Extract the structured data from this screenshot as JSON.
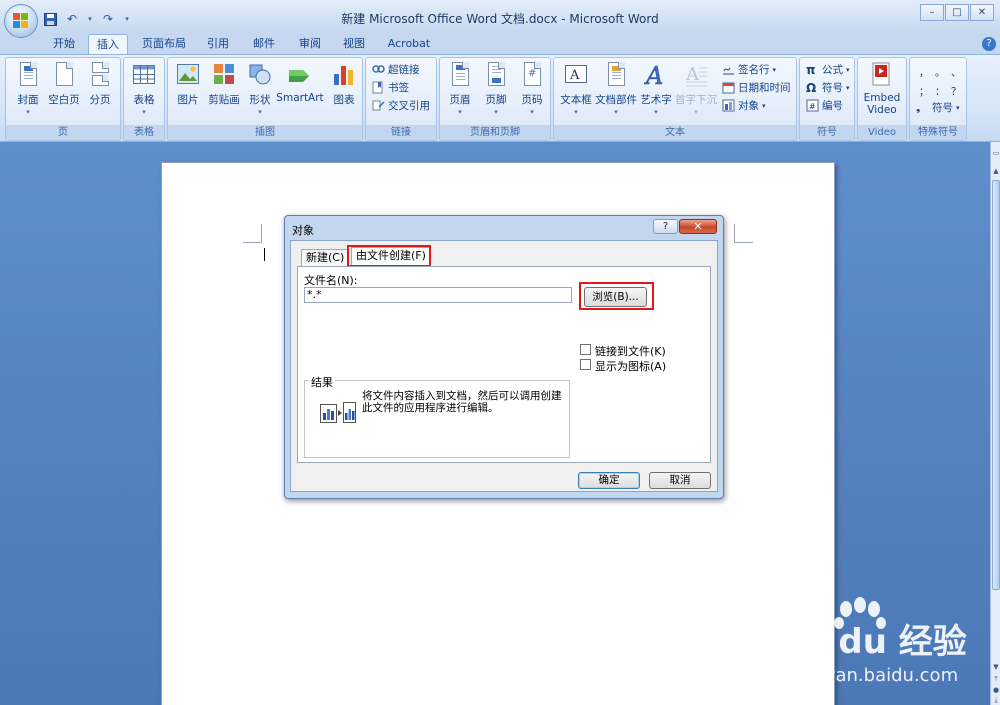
{
  "window": {
    "title": "新建 Microsoft Office Word 文档.docx - Microsoft Word",
    "controls": {
      "minimize": "–",
      "maximize": "□",
      "close": "✕"
    }
  },
  "quick_access": [
    "save-icon",
    "undo-icon",
    "dropdown-icon",
    "redo-icon",
    "customize-icon"
  ],
  "ribbon_tabs": [
    "开始",
    "插入",
    "页面布局",
    "引用",
    "邮件",
    "审阅",
    "视图",
    "Acrobat"
  ],
  "active_tab": "插入",
  "ribbon_groups": {
    "pages": {
      "label": "页",
      "buttons": [
        "封面",
        "空白页",
        "分页"
      ]
    },
    "tables": {
      "label": "表格",
      "buttons": [
        "表格"
      ]
    },
    "illustrations": {
      "label": "插图",
      "buttons": [
        "图片",
        "剪贴画",
        "形状",
        "SmartArt",
        "图表"
      ]
    },
    "links": {
      "label": "链接",
      "buttons": [
        "超链接",
        "书签",
        "交叉引用"
      ]
    },
    "header_footer": {
      "label": "页眉和页脚",
      "buttons": [
        "页眉",
        "页脚",
        "页码"
      ]
    },
    "text": {
      "label": "文本",
      "buttons": [
        "文本框",
        "文档部件",
        "艺术字",
        "首字下沉"
      ],
      "small": [
        "签名行",
        "日期和时间",
        "对象"
      ]
    },
    "symbols": {
      "label": "符号",
      "small": [
        "公式",
        "符号",
        "编号"
      ]
    },
    "video": {
      "label": "Video",
      "button": "Embed Video"
    },
    "special": {
      "label": "特殊符号",
      "symbol_label": "符号",
      "glyphs": [
        "，",
        "。",
        "、",
        "；",
        "：",
        "？"
      ]
    }
  },
  "dialog": {
    "title": "对象",
    "help": "?",
    "close": "✕",
    "tabs": [
      "新建(C)",
      "由文件创建(F)"
    ],
    "filename_label": "文件名(N):",
    "filename_value": "*.*",
    "browse": "浏览(B)...",
    "checkboxes": [
      "链接到文件(K)",
      "显示为图标(A)"
    ],
    "result_label": "结果",
    "result_text": "将文件内容插入到文档，然后可以调用创建此文件的应用程序进行编辑。",
    "ok": "确定",
    "cancel": "取消"
  },
  "watermark": {
    "brand": "Bai du 经验",
    "url": "jingyan.baidu.com"
  }
}
